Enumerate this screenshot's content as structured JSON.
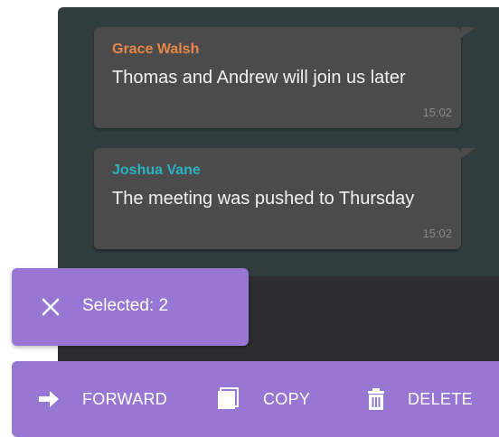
{
  "messages": [
    {
      "sender": "Grace Walsh",
      "text": "Thomas and Andrew will join us later",
      "time": "15:02",
      "sender_color": "#e7874a"
    },
    {
      "sender": "Joshua Vane",
      "text": "The meeting was pushed to Thursday",
      "time": "15:02",
      "sender_color": "#2bb3c0"
    }
  ],
  "selection": {
    "label": "Selected: 2",
    "close_icon": "close-icon"
  },
  "actions": {
    "forward": {
      "label": "FORWARD",
      "icon": "arrow-right-icon"
    },
    "copy": {
      "label": "COPY",
      "icon": "copy-icon"
    },
    "delete": {
      "label": "DELETE",
      "icon": "trash-icon"
    }
  },
  "colors": {
    "accent": "#9876d3",
    "chat_background": "#2f3d3e",
    "bubble": "#4b4b4c"
  }
}
